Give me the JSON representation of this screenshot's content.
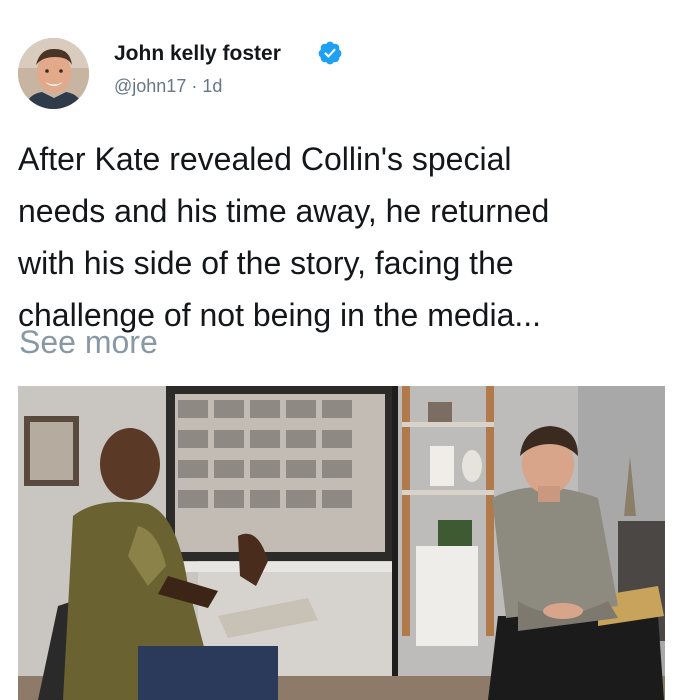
{
  "post": {
    "author_name": "John kelly foster",
    "handle": "@john17",
    "separator": " · ",
    "time": "1d",
    "verified": true,
    "text_lines": [
      "After Kate revealed Collin's special",
      "needs and his time away, he returned",
      "with his side of the story, facing the",
      "challenge of not being in the media..."
    ],
    "see_more": "See more"
  },
  "icons": {
    "verified": "verified-check-icon"
  },
  "colors": {
    "verified_blue": "#1da1f2",
    "secondary_text": "#657786",
    "see_more": "#8899a6"
  }
}
